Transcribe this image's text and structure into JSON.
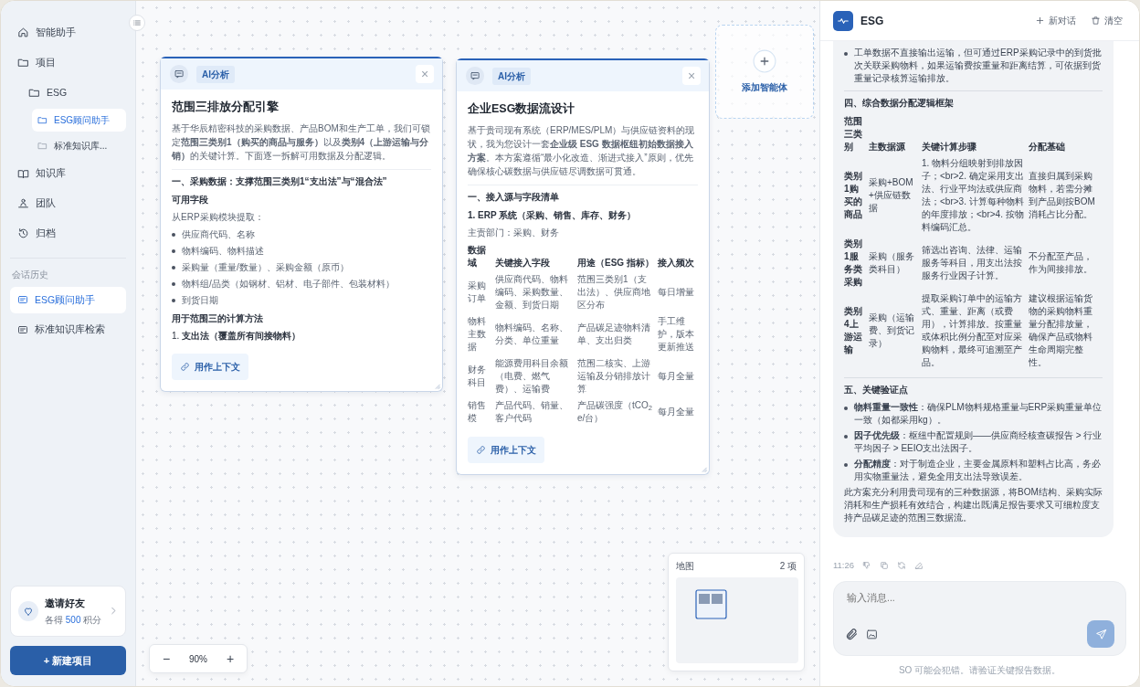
{
  "sidebar": {
    "nav": [
      {
        "label": "智能助手",
        "selected": false
      },
      {
        "label": "项目",
        "selected": false,
        "children": [
          {
            "label": "ESG",
            "selected": false,
            "children": [
              {
                "label": "ESG顾问助手",
                "selected": true
              },
              {
                "label": "标准知识库...",
                "selected": false
              }
            ]
          }
        ]
      },
      {
        "label": "知识库",
        "selected": false
      },
      {
        "label": "团队",
        "selected": false
      },
      {
        "label": "归档",
        "selected": false
      }
    ],
    "history_title": "会话历史",
    "history": [
      {
        "label": "ESG顾问助手",
        "selected": true
      },
      {
        "label": "标准知识库检索",
        "selected": false
      }
    ],
    "invite": {
      "title": "邀请好友",
      "prefix": "各得",
      "points": "500",
      "suffix": "积分"
    },
    "new_project": "+ 新建项目"
  },
  "canvas": {
    "cards": [
      {
        "badge": "AI分析",
        "close": "×",
        "title": "范围三排放分配引擎",
        "intro": "基于华辰精密科技的采购数据、产品BOM和生产工单，我们可锁定**范围三类别1（购买的商品与服务）**以及**类别4（上游运输与分销）**的关键计算。下面逐一拆解可用数据及分配逻辑。",
        "blocks": [
          {
            "kind": "heading",
            "text": "一、采购数据：支撑范围三类别1“支出法”与“混合法”"
          },
          {
            "kind": "label",
            "text": "可用字段"
          },
          {
            "kind": "text",
            "text": "从ERP采购模块提取："
          },
          {
            "kind": "bullets",
            "items": [
              "供应商代码、名称",
              "物料编码、物料描述",
              "采购量（重量/数量）、采购金额（原币）",
              "物料组/品类（如钢材、铝材、电子部件、包装材料）",
              "到货日期"
            ]
          },
          {
            "kind": "label",
            "text": "用于范围三的计算方法"
          },
          {
            "kind": "ordered",
            "items": [
              "1. **支出法（覆盖所有间接物料）**"
            ]
          }
        ],
        "action": "用作上下文"
      },
      {
        "badge": "AI分析",
        "close": "×",
        "title": "企业ESG数据流设计",
        "intro": "基于贵司现有系统（ERP/MES/PLM）与供应链资料的现状，我为您设计一套**企业级 ESG 数据枢纽初始数据接入方案**。本方案遵循“最小化改造、渐进式接入”原则，优先确保核心碳数据与供应链尽调数据可贯通。",
        "blocks": [
          {
            "kind": "heading",
            "text": "一、接入源与字段清单"
          },
          {
            "kind": "label",
            "text": "1. ERP 系统（采购、销售、库存、财务）"
          },
          {
            "kind": "text",
            "text": "主责部门：采购、财务"
          },
          {
            "kind": "table",
            "columns": [
              "数据域",
              "关键接入字段",
              "用途（ESG 指标）",
              "接入频次"
            ],
            "rows": [
              [
                "采购订单",
                "供应商代码、物料编码、采购数量、金额、到货日期",
                "范围三类别1（支出法）、供应商地区分布",
                "每日增量"
              ],
              [
                "物料主数据",
                "物料编码、名称、分类、单位重量",
                "产品碳足迹物料清单、支出归类",
                "手工维护，版本更新推送"
              ],
              [
                "财务科目",
                "能源费用科目余额（电费、燃气费）、运输费",
                "范围二核实、上游运输及分销排放计算",
                "每月全量"
              ],
              [
                "销售模",
                "产品代码、销量、客户代码",
                "产品碳强度（tCO$_{2}$e/台）",
                "每月全量"
              ]
            ]
          }
        ],
        "action": "用作上下文"
      }
    ],
    "add_agent": "添加智能体",
    "minimap": {
      "title": "地图",
      "count": "2 项"
    },
    "zoom": {
      "out": "−",
      "level": "90%",
      "in": "+"
    }
  },
  "chat": {
    "title": "ESG",
    "actions": [
      "新对话",
      "清空"
    ],
    "blocks": [
      {
        "kind": "bullets",
        "items": [
          "工单数据不直接输出运输，但可通过ERP采购记录中的到货批次关联采购物料，如果运输费按重量和距离结算，可依据到货重量记录核算运输排放。"
        ]
      },
      {
        "kind": "divider"
      },
      {
        "kind": "heading",
        "text": "四、综合数据分配逻辑框架"
      },
      {
        "kind": "table",
        "columns": [
          "范围三类别",
          "主数据源",
          "关键计算步骤",
          "分配基础"
        ],
        "rows": [
          [
            "类别1购买的商品",
            "采购+BOM+供应链数据",
            "1. 物料分组映射到排放因子；<br>2. 确定采用支出法、行业平均法或供应商法；<br>3. 计算每种物料的年度排放；<br>4. 按物料编码汇总。",
            "直接归属到采购物料，若需分摊到产品则按BOM消耗占比分配。"
          ],
          [
            "类别1服务类采购",
            "采购（服务类科目）",
            "筛选出咨询、法律、运输服务等科目，用支出法按服务行业因子计算。",
            "不分配至产品，作为间接排放。"
          ],
          [
            "类别4上游运输",
            "采购（运输费、到货记录）",
            "提取采购订单中的运输方式、重量、距离（或费用），计算排放。按重量或体积比例分配至对应采购物料，最终可追溯至产品。",
            "建议根据运输货物的采购物料重量分配排放量，确保产品或物料生命周期完整性。"
          ]
        ]
      },
      {
        "kind": "divider"
      },
      {
        "kind": "heading",
        "text": "五、关键验证点"
      },
      {
        "kind": "bullets",
        "items": [
          "**物料重量一致性**：确保PLM物料规格重量与ERP采购重量单位一致（如都采用kg）。",
          "**因子优先级**：枢纽中配置规则——供应商经核查碳报告 > 行业平均因子 > EEIO支出法因子。",
          "**分配精度**：对于制造企业，主要金属原料和塑料占比高，务必用实物重量法，避免全用支出法导致误差。"
        ]
      },
      {
        "kind": "text",
        "text": "此方案充分利用贵司现有的三种数据源，将BOM结构、采购实际消耗和生产损耗有效结合，构建出既满足报告要求又可细粒度支持产品碳足迹的范围三数据流。"
      }
    ],
    "time": "11:26",
    "placeholder": "输入消息...",
    "footer": "SO 可能会犯错。请验证关键报告数据。"
  }
}
